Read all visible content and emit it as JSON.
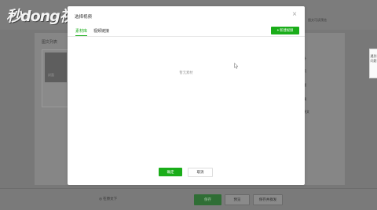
{
  "watermark": {
    "text": "秒dong视频"
  },
  "background_page": {
    "list_title": "图文列表",
    "thumb_label": "封面",
    "top_right_link": "图文可读预览",
    "side_items": [
      "外",
      "页",
      "题",
      "摘",
      "原文"
    ],
    "bottom": {
      "radio_label": "◎ 在原文下",
      "save_label": "保存",
      "preview_label": "预览",
      "publish_label": "保存并群发"
    }
  },
  "feedback": {
    "label": "遇到问题"
  },
  "modal": {
    "title": "选择视频",
    "close_icon": "close-icon",
    "tabs": [
      {
        "label": "素材库",
        "active": true
      },
      {
        "label": "视频链接",
        "active": false
      }
    ],
    "new_video_button": {
      "plus": "+",
      "label": "新建视频"
    },
    "empty_text": "暂无素材",
    "confirm_label": "确定",
    "cancel_label": "取消",
    "accent_color": "#1aad19"
  }
}
